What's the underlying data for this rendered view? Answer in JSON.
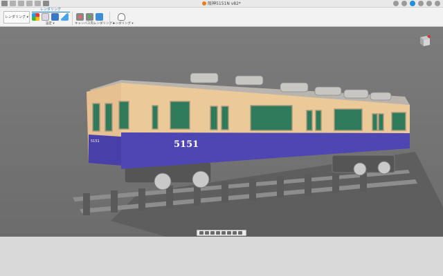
{
  "titlebar": {
    "doc_title": "阪神5151N v82*"
  },
  "toolbar": {
    "workspace_label": "レンダリング ▾",
    "active_tab": "レンダリング",
    "groups": [
      {
        "label": "設定 ▾"
      },
      {
        "label": "キャンバス内レンダリング ▾"
      },
      {
        "label": "レンダリング ▾"
      }
    ]
  },
  "scene": {
    "car_number": "5151",
    "car_number_small": "5151",
    "colors": {
      "upper_body": "#ecc998",
      "lower_body": "#4e46b2",
      "roof": "#b9b5ae",
      "window_glass": "#2f7a5a",
      "rail": "#8d8d8d"
    }
  }
}
